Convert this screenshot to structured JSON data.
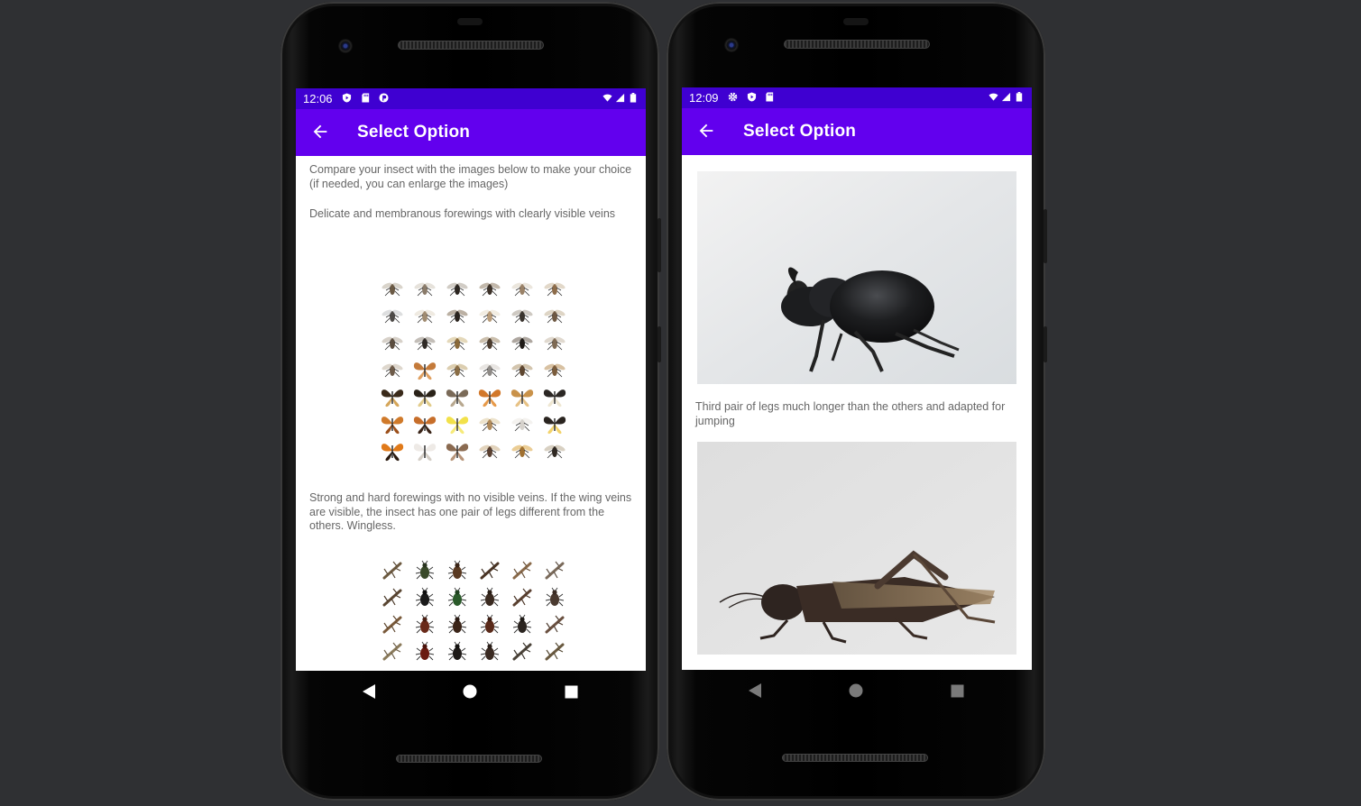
{
  "left_screen": {
    "status": {
      "time": "12:06",
      "icons": [
        "shield-play-icon",
        "sd-card-icon",
        "p-circle-icon",
        "wifi-icon",
        "signal-icon",
        "battery-icon"
      ]
    },
    "app_bar": {
      "title": "Select Option",
      "back_icon": "arrow-back-icon"
    },
    "intro": "Compare your insect with the images below to make your choice (if needed, you can enlarge the images)",
    "options": [
      {
        "text": "Delicate and membranous forewings with clearly visible veins",
        "image": "winged-insects-collage"
      },
      {
        "text": "Strong and hard forewings with no visible veins. If the wing veins are visible, the insect has one pair of legs different from the others. Wingless.",
        "image": "beetles-bugs-collage"
      }
    ]
  },
  "right_screen": {
    "status": {
      "time": "12:09",
      "icons": [
        "gear-icon",
        "shield-play-icon",
        "sd-card-icon",
        "wifi-icon",
        "signal-icon",
        "battery-icon"
      ]
    },
    "app_bar": {
      "title": "Select Option",
      "back_icon": "arrow-back-icon"
    },
    "options": [
      {
        "text": "",
        "image": "rhinoceros-beetle-photo"
      },
      {
        "text": "Third pair of legs much longer than the others and adapted for jumping",
        "image": "grasshopper-photo"
      }
    ]
  },
  "navigation": {
    "buttons": [
      "back-triangle-icon",
      "home-circle-icon",
      "recents-square-icon"
    ]
  },
  "colors": {
    "status_bar": "#3f00d1",
    "app_bar": "#6200ee",
    "background": "#2f3033",
    "body_text": "#666666"
  }
}
